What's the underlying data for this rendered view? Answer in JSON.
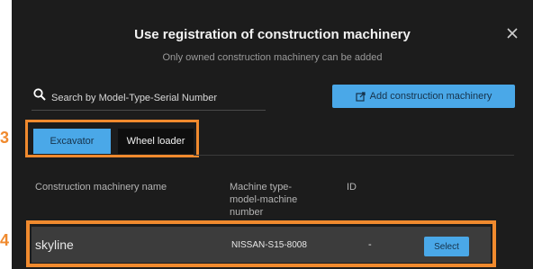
{
  "dialog": {
    "title": "Use registration of construction machinery",
    "subtitle": "Only owned construction machinery can be added",
    "close_icon": "close-icon"
  },
  "search": {
    "placeholder": "Search by Model-Type-Serial Number",
    "value": "",
    "icon": "search-icon"
  },
  "add_button": {
    "label": "Add construction machinery",
    "icon": "external-link-icon"
  },
  "tabs": [
    {
      "label": "Excavator",
      "selected": true
    },
    {
      "label": "Wheel loader",
      "selected": false
    }
  ],
  "table": {
    "headers": [
      "Construction machinery name",
      "Machine type-model-machine number",
      "ID"
    ],
    "rows": [
      {
        "name": "skyline",
        "model": "NISSAN-S15-8008",
        "id": "-",
        "action": "Select"
      }
    ]
  },
  "annotations": {
    "marker_3": "3",
    "marker_4": "4"
  },
  "colors": {
    "accent": "#4aa8e8",
    "highlight": "#f08a2e",
    "background": "#1c1c1c"
  }
}
